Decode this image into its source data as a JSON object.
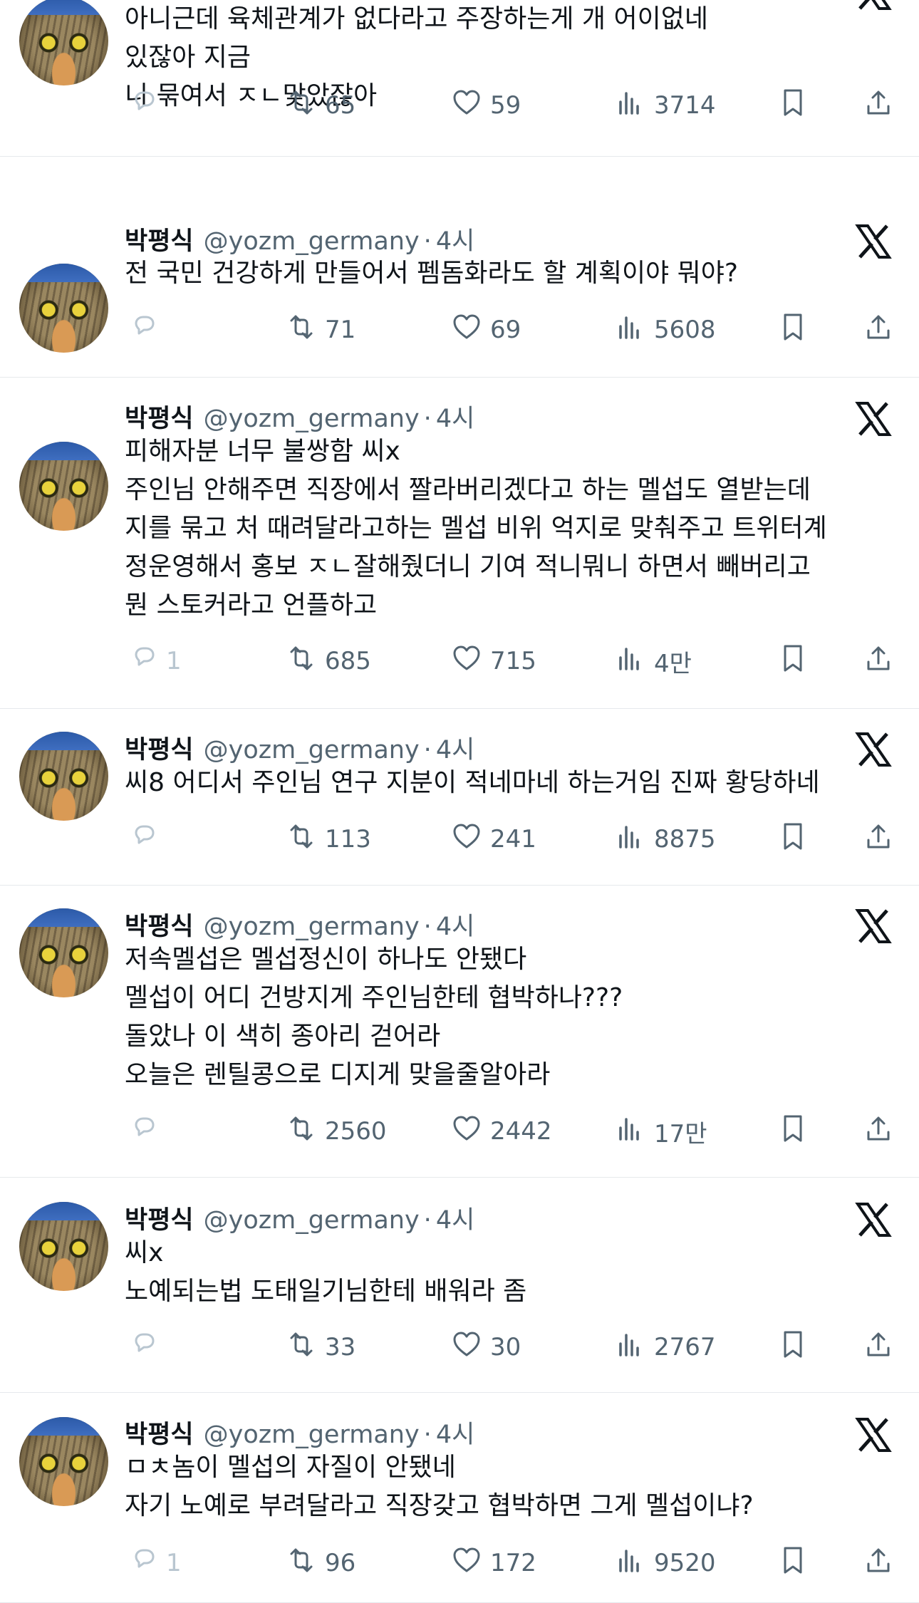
{
  "tweets": [
    {
      "author_name": "",
      "handle": "",
      "time": "",
      "lines": [
        "아니근데 육체관계가 없다라고 주장하는게 개 어이없네",
        "있잖아 지금",
        "니 묶여서 ㅈㄴ맞았잖아"
      ],
      "replies": "",
      "retweets": "65",
      "likes": "59",
      "views": "3714"
    },
    {
      "author_name": "박평식",
      "handle": "@yozm_germany",
      "time": "4시",
      "lines": [
        "전 국민 건강하게 만들어서 펨돔화라도 할 계획이야 뭐야?"
      ],
      "replies": "",
      "retweets": "71",
      "likes": "69",
      "views": "5608"
    },
    {
      "author_name": "박평식",
      "handle": "@yozm_germany",
      "time": "4시",
      "lines": [
        "피해자분 너무 불쌍함 씨x",
        "주인님 안해주면 직장에서 짤라버리겠다고 하는 멜섭도 열받는데",
        "지를 묶고 처 때려달라고하는 멜섭 비위 억지로 맞춰주고 트위터계",
        "정운영해서 홍보 ㅈㄴ잘해줬더니 기여 적니뭐니 하면서 빼버리고",
        "뭔 스토커라고 언플하고"
      ],
      "replies": "1",
      "retweets": "685",
      "likes": "715",
      "views": "4만"
    },
    {
      "author_name": "박평식",
      "handle": "@yozm_germany",
      "time": "4시",
      "lines": [
        "씨8 어디서 주인님 연구 지분이 적네마네 하는거임 진짜 황당하네"
      ],
      "replies": "",
      "retweets": "113",
      "likes": "241",
      "views": "8875"
    },
    {
      "author_name": "박평식",
      "handle": "@yozm_germany",
      "time": "4시",
      "lines": [
        "저속멜섭은 멜섭정신이 하나도 안됐다",
        "멜섭이 어디 건방지게 주인님한테 협박하나???",
        "돌았나 이 색히 종아리 걷어라",
        "오늘은 렌틸콩으로 디지게 맞을줄알아라"
      ],
      "replies": "",
      "retweets": "2560",
      "likes": "2442",
      "views": "17만"
    },
    {
      "author_name": "박평식",
      "handle": "@yozm_germany",
      "time": "4시",
      "lines": [
        "씨x",
        "노예되는법 도태일기님한테 배워라 좀"
      ],
      "replies": "",
      "retweets": "33",
      "likes": "30",
      "views": "2767"
    },
    {
      "author_name": "박평식",
      "handle": "@yozm_germany",
      "time": "4시",
      "lines": [
        "ㅁㅊ놈이 멜섭의 자질이 안됐네",
        "자기 노예로 부려달라고 직장갖고 협박하면 그게 멜섭이냐?"
      ],
      "replies": "1",
      "retweets": "96",
      "likes": "172",
      "views": "9520"
    }
  ],
  "colors": {
    "text": "#0f1419",
    "secondary": "#536471",
    "divider": "#e6e9ec",
    "reply_faded": "#b9c6d0"
  },
  "icons": [
    "reply-icon",
    "retweet-icon",
    "like-icon",
    "views-icon",
    "bookmark-icon",
    "share-icon",
    "x-logo-icon"
  ]
}
